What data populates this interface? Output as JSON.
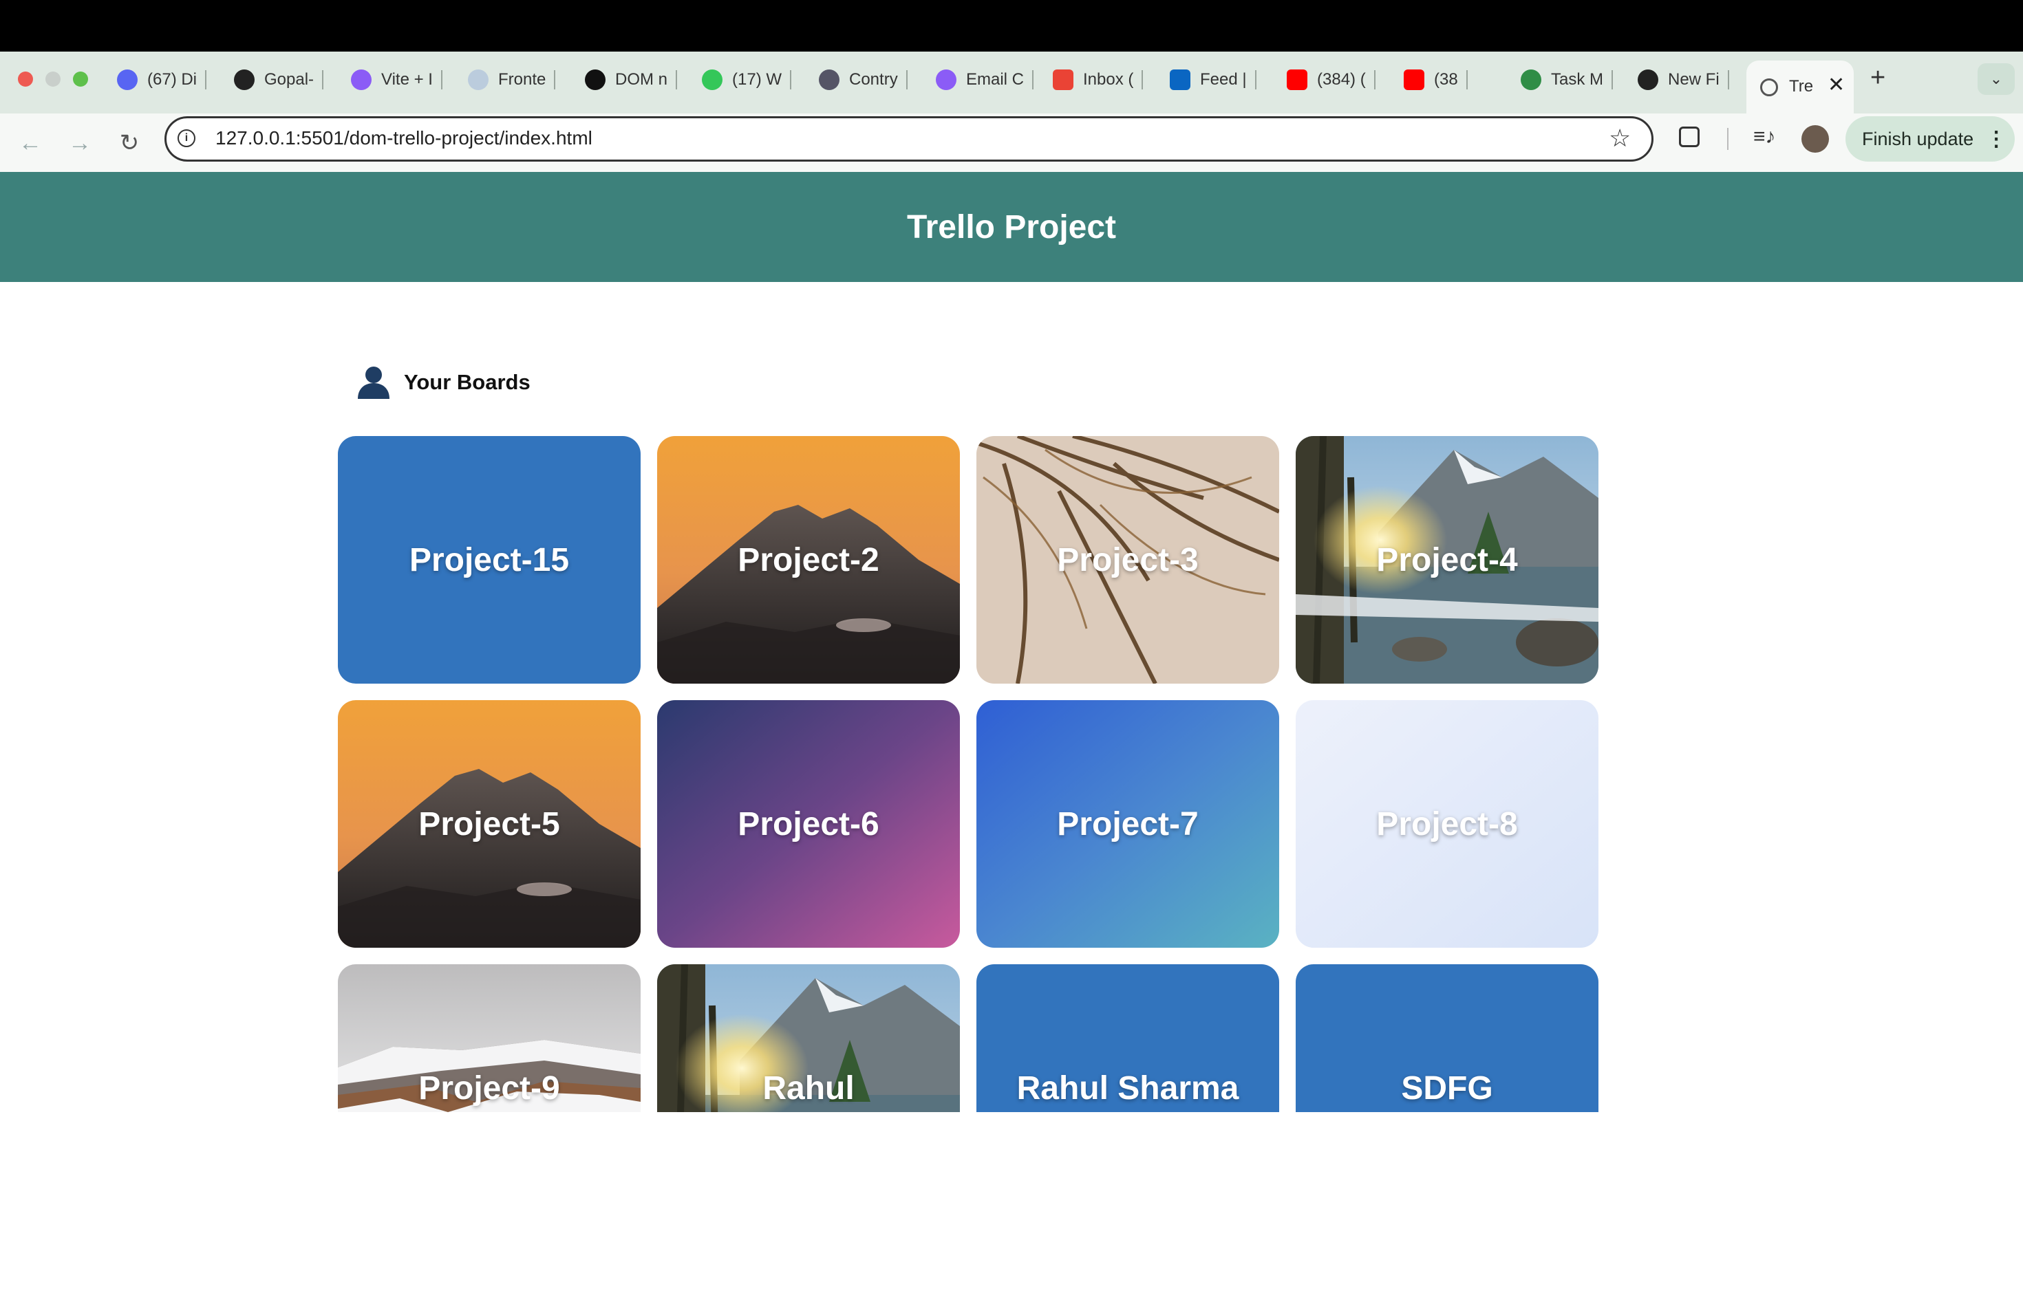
{
  "browser": {
    "tabs": [
      {
        "label": "(67) Di",
        "icon": "discord-icon",
        "badge": "67"
      },
      {
        "label": "Gopal-",
        "icon": "github-icon"
      },
      {
        "label": "Vite + I",
        "icon": "vite-icon"
      },
      {
        "label": "Fronte",
        "icon": "page-icon"
      },
      {
        "label": "DOM n",
        "icon": "openai-icon"
      },
      {
        "label": "(17) W",
        "icon": "whatsapp-icon",
        "badge": "17"
      },
      {
        "label": "Contry",
        "icon": "globe-icon"
      },
      {
        "label": "Email C",
        "icon": "vite-icon"
      },
      {
        "label": "Inbox (",
        "icon": "gmail-icon"
      },
      {
        "label": "Feed |",
        "icon": "linkedin-icon"
      },
      {
        "label": "(384) (",
        "icon": "youtube-icon"
      },
      {
        "label": "(38",
        "icon": "youtube-icon"
      },
      {
        "label": "Task M",
        "icon": "geeks-icon"
      },
      {
        "label": "New Fi",
        "icon": "github-icon"
      }
    ],
    "active_tab": {
      "label": "Tre",
      "icon": "globe-icon"
    },
    "url": "127.0.0.1:5501/dom-trello-project/index.html",
    "finish_update": "Finish update",
    "accent": "#dfe9e2"
  },
  "header": {
    "title": "Trello Project",
    "color": "#3d817b"
  },
  "boards_section": {
    "title": "Your Boards"
  },
  "boards": [
    {
      "name": "Project-15",
      "bg": "solid-blue"
    },
    {
      "name": "Project-2",
      "bg": "mountain-sunset"
    },
    {
      "name": "Project-3",
      "bg": "palm-leaves"
    },
    {
      "name": "Project-4",
      "bg": "lake-sunburst"
    },
    {
      "name": "Project-5",
      "bg": "mountain-sunset"
    },
    {
      "name": "Project-6",
      "bg": "gradient-purple"
    },
    {
      "name": "Project-7",
      "bg": "gradient-blue-teal"
    },
    {
      "name": "Project-8",
      "bg": "gradient-pale"
    },
    {
      "name": "Project-9",
      "bg": "snowy-hills"
    },
    {
      "name": "Rahul",
      "bg": "lake-sunburst"
    },
    {
      "name": "Rahul Sharma",
      "bg": "solid-blue"
    },
    {
      "name": "SDFG",
      "bg": "solid-blue"
    }
  ]
}
